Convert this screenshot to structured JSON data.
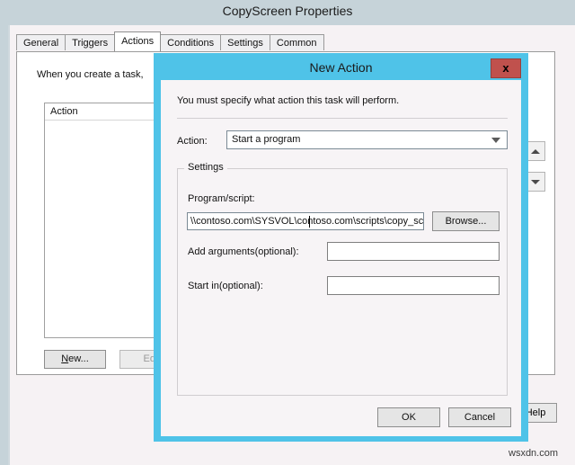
{
  "parent_window": {
    "title": "CopyScreen Properties",
    "tabs": [
      {
        "label": "General",
        "active": false
      },
      {
        "label": "Triggers",
        "active": false
      },
      {
        "label": "Actions",
        "active": true
      },
      {
        "label": "Conditions",
        "active": false
      },
      {
        "label": "Settings",
        "active": false
      },
      {
        "label": "Common",
        "active": false
      }
    ],
    "intro_text": "When you create a task, ",
    "list_header": "Action",
    "buttons": {
      "new": "New...",
      "new_accelerator": "N",
      "edit": "Edi",
      "help": "Help"
    },
    "spin": {
      "up_icon": "arrow-up-icon",
      "down_icon": "arrow-down-icon"
    }
  },
  "dialog": {
    "title": "New Action",
    "close_label": "x",
    "instruction": "You must specify what action this task will perform.",
    "action_label": "Action:",
    "action_value": "Start a program",
    "action_options": [
      "Start a program"
    ],
    "settings_group_label": "Settings",
    "program_script_label": "Program/script:",
    "program_script_value": "\\\\contoso.com\\SYSVOL\\contoso.com\\scripts\\copy_scr",
    "browse_label": "Browse...",
    "add_arguments_label": "Add arguments(optional):",
    "add_arguments_value": "",
    "start_in_label": "Start in(optional):",
    "start_in_value": "",
    "ok_label": "OK",
    "cancel_label": "Cancel"
  },
  "watermark": "wsxdn.com",
  "colors": {
    "dialog_accent": "#4fc3e8",
    "close_button": "#c0514d",
    "parent_titlebar": "#c6d3d9",
    "dialog_client": "#f7f4f6"
  }
}
